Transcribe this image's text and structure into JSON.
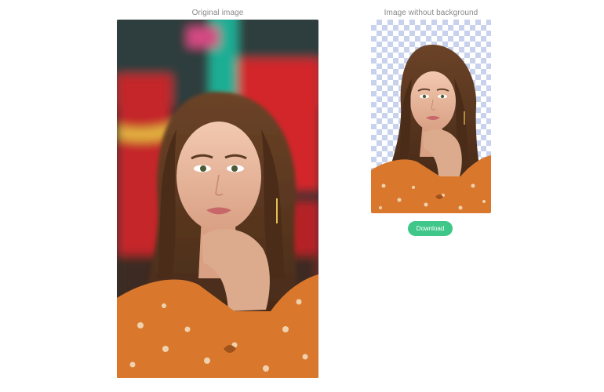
{
  "original": {
    "caption": "Original image"
  },
  "result": {
    "caption": "Image without background",
    "transparency_pattern_color": "#c8d2ec"
  },
  "actions": {
    "download_label": "Download"
  },
  "colors": {
    "accent": "#3fc689",
    "caption_text": "#8a8a8a",
    "background": "#ffffff"
  }
}
